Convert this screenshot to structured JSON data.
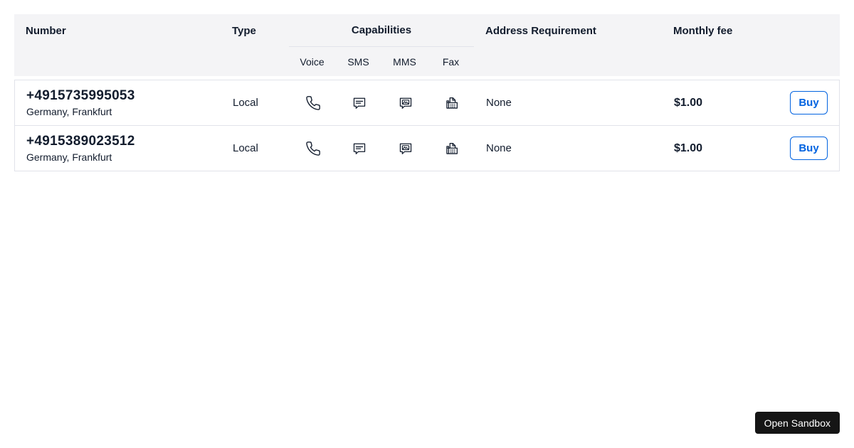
{
  "table": {
    "columns": {
      "number": "Number",
      "type": "Type",
      "capabilities": "Capabilities",
      "capability_columns": [
        "Voice",
        "SMS",
        "MMS",
        "Fax"
      ],
      "address_requirement": "Address Requirement",
      "monthly_fee": "Monthly fee"
    },
    "rows": [
      {
        "number": "+4915735995053",
        "location": "Germany, Frankfurt",
        "type": "Local",
        "capabilities": {
          "voice": true,
          "sms": true,
          "mms": true,
          "fax": true
        },
        "address_requirement": "None",
        "monthly_fee": "$1.00",
        "buy_label": "Buy"
      },
      {
        "number": "+4915389023512",
        "location": "Germany, Frankfurt",
        "type": "Local",
        "capabilities": {
          "voice": true,
          "sms": true,
          "mms": true,
          "fax": true
        },
        "address_requirement": "None",
        "monthly_fee": "$1.00",
        "buy_label": "Buy"
      }
    ]
  },
  "sandbox_button": {
    "label": "Open Sandbox"
  },
  "colors": {
    "accent_blue": "#0263E0",
    "header_background": "#F4F4F6",
    "border": "#E1E3EA",
    "text": "#121C2D",
    "sandbox_background": "#151515"
  }
}
